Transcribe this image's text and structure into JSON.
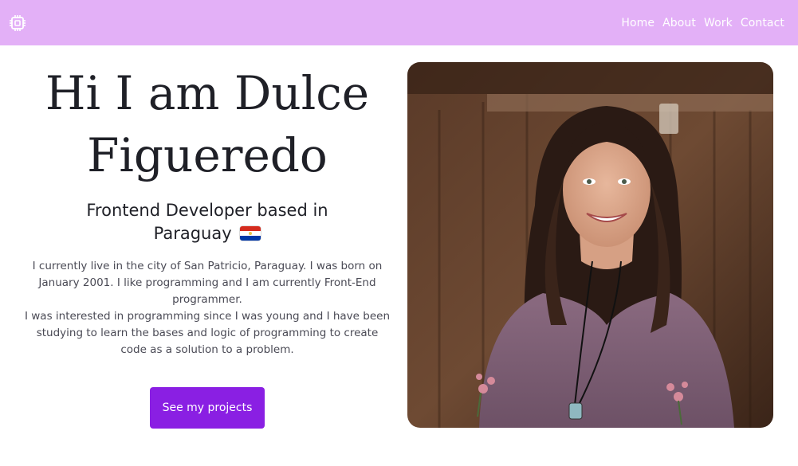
{
  "nav": {
    "logo_icon": "chip-icon",
    "links": [
      "Home",
      "About",
      "Work",
      "Contact"
    ]
  },
  "hero": {
    "title_line1": "Hi I am Dulce",
    "title_line2": "Figueredo",
    "subtitle": "Frontend Developer based in Paraguay",
    "flag_icon": "paraguay-flag-icon",
    "desc_p1": "I currently live in the city of San Patricio, Paraguay. I was born on January 2001. I like programming and I am currently Front-End programmer.",
    "desc_p2": "I was interested in programming since I was young and I have been studying to learn the bases and logic of programming to create code as a solution to a problem.",
    "cta_label": "See my projects"
  },
  "colors": {
    "navbar": "#e3b0f7",
    "accent": "#8a1fe3",
    "heading": "#1f2027",
    "body_text": "#4a4a55"
  }
}
